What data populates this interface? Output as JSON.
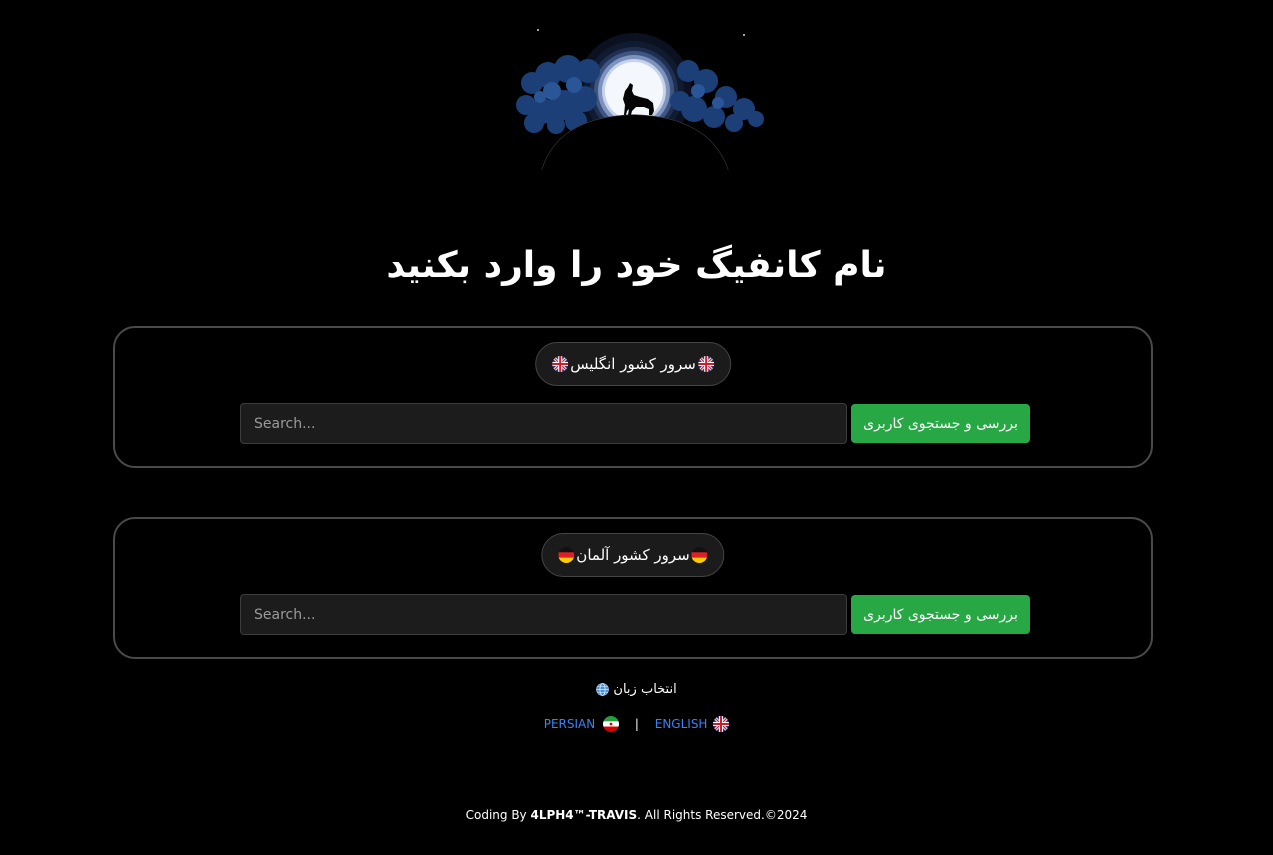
{
  "header": {
    "title": "نام کانفیگ خود را وارد بکنید"
  },
  "servers": [
    {
      "label": "سرور کشور انگلیس",
      "flag": "uk-flag-icon",
      "search_placeholder": "Search...",
      "search_value": "",
      "button_label": "بررسی و جستجوی کاربری"
    },
    {
      "label": "سرور کشور آلمان",
      "flag": "germany-flag-icon",
      "search_placeholder": "Search...",
      "search_value": "",
      "button_label": "بررسی و جستجوی کاربری"
    }
  ],
  "language": {
    "title": "انتخاب زبان",
    "icon": "globe-icon",
    "separator": "|",
    "options": [
      {
        "label": "PERSIAN",
        "flag": "iran-flag-icon"
      },
      {
        "label": "ENGLISH",
        "flag": "uk-flag-icon"
      }
    ]
  },
  "footer": {
    "prefix": "Coding By ",
    "author": "4LPH4™-TRAVIS",
    "suffix": ". All Rights Reserved.©2024"
  },
  "colors": {
    "background": "#000000",
    "accent_green": "#28a745",
    "link_blue": "#3b82f6",
    "box_border": "#4a4a4a"
  }
}
